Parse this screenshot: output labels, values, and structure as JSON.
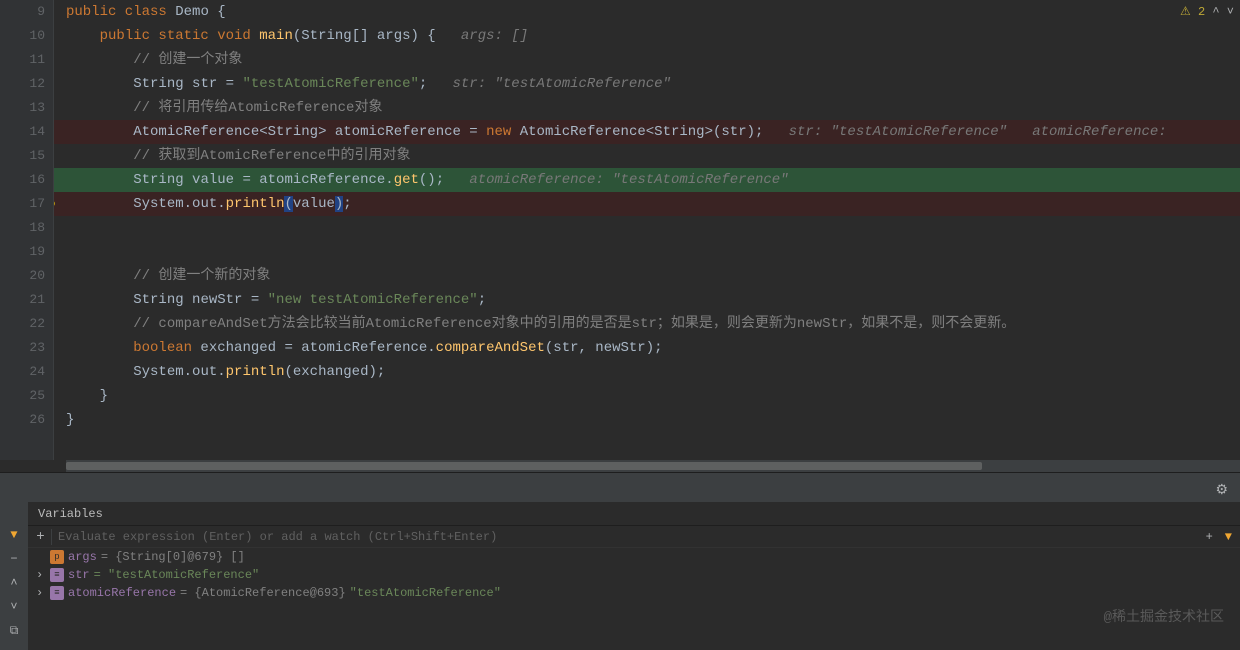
{
  "status": {
    "warnings": "2"
  },
  "lines": {
    "l9": "public class Demo {",
    "l10": "    public static void main(String[] args) {   args: []",
    "l11": "        // 创建一个对象",
    "l12": "        String str = \"testAtomicReference\";   str: \"testAtomicReference\"",
    "l13": "        // 将引用传给AtomicReference对象",
    "l14": "        AtomicReference<String> atomicReference = new AtomicReference<String>(str);   str: \"testAtomicReference\"   atomicReference:",
    "l15": "        // 获取到AtomicReference中的引用对象",
    "l16": "        String value = atomicReference.get();   atomicReference: \"testAtomicReference\"",
    "l17": "        System.out.println(value);",
    "l21": "        String newStr = \"new testAtomicReference\";",
    "l20": "        // 创建一个新的对象",
    "l22": "        // compareAndSet方法会比较当前AtomicReference对象中的引用的是否是str；如果是，则会更新为newStr，如果不是，则不会更新。",
    "l23": "        boolean exchanged = atomicReference.compareAndSet(str, newStr);",
    "l24": "        System.out.println(exchanged);",
    "l25": "    }",
    "l26": "}"
  },
  "gutter": [
    "9",
    "10",
    "11",
    "12",
    "13",
    "14",
    "15",
    "16",
    "17",
    "18",
    "19",
    "20",
    "21",
    "22",
    "23",
    "24",
    "25",
    "26"
  ],
  "debug": {
    "tab": "Variables",
    "eval_placeholder": "Evaluate expression (Enter) or add a watch (Ctrl+Shift+Enter)",
    "vars": [
      {
        "icon": "p",
        "name": "args",
        "meta": " = {String[0]@679} []"
      },
      {
        "icon": "o",
        "name": "str",
        "val": " = \"testAtomicReference\"",
        "arrow": true
      },
      {
        "icon": "o",
        "name": "atomicReference",
        "meta": " = {AtomicReference@693}",
        "val": " \"testAtomicReference\"",
        "arrow": true
      }
    ]
  },
  "watermark": "@稀土掘金技术社区"
}
